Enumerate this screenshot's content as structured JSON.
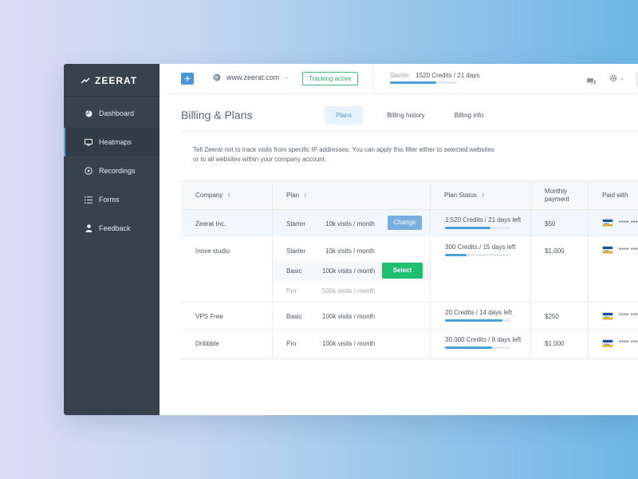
{
  "brand": {
    "name": "ZEERAT"
  },
  "sidebar": {
    "items": [
      {
        "label": "Dashboard",
        "icon": "pie-chart-icon"
      },
      {
        "label": "Heatmaps",
        "icon": "monitor-icon"
      },
      {
        "label": "Recordings",
        "icon": "play-circle-icon"
      },
      {
        "label": "Forms",
        "icon": "list-icon"
      },
      {
        "label": "Feedback",
        "icon": "user-icon"
      }
    ],
    "active": "Heatmaps"
  },
  "topbar": {
    "add_label": "+",
    "site": "www.zeerat.com",
    "tracking": "Tracking active",
    "plan_name": "Starter",
    "plan_credits": "1520 Credits / 21 days",
    "plan_progress": 0.69
  },
  "page": {
    "title": "Billing & Plans",
    "tabs": [
      "Plans",
      "Billing history",
      "Billing info"
    ],
    "active_tab": "Plans",
    "description": "Tell Zeerat not to track visits from specific IP addresses. You can apply this filter either to selected websites or to all websites within your company account."
  },
  "table": {
    "headers": {
      "company": "Company",
      "plan": "Plan",
      "status": "Plan Status",
      "payment": "Monthly payment",
      "paid": "Paid with"
    },
    "rows": [
      {
        "company": "Zeerat Inc.",
        "plans": [
          {
            "name": "Starter",
            "visits": "10k visits / month",
            "action": "Change"
          }
        ],
        "status": "1,520 Credits / 21 days left",
        "progress": 0.69,
        "payment": "$50",
        "card": "**** ****"
      },
      {
        "company": "Inove studio",
        "plans": [
          {
            "name": "Starter",
            "visits": "10k visits / month"
          },
          {
            "name": "Basic",
            "visits": "100k visits / month",
            "action": "Select"
          },
          {
            "name": "Pro",
            "visits": "500k visits / month"
          }
        ],
        "status": "300 Credits / 15 days left",
        "progress": 0.33,
        "payment": "$1,000",
        "card": "**** ****"
      },
      {
        "company": "VPS Free",
        "plans": [
          {
            "name": "Basic",
            "visits": "100k visits / month"
          }
        ],
        "status": "20 Credits / 14 days left",
        "progress": 0.88,
        "payment": "$250",
        "card": "**** ****"
      },
      {
        "company": "Dribbble",
        "plans": [
          {
            "name": "Pro",
            "visits": "100k visits / month"
          }
        ],
        "status": "30,000 Credits / 8 days left",
        "progress": 0.72,
        "payment": "$1,000",
        "card": "**** ****"
      }
    ]
  },
  "colors": {
    "accent": "#4a97d6",
    "sidebar": "#37424d",
    "success": "#1ebf6f"
  }
}
